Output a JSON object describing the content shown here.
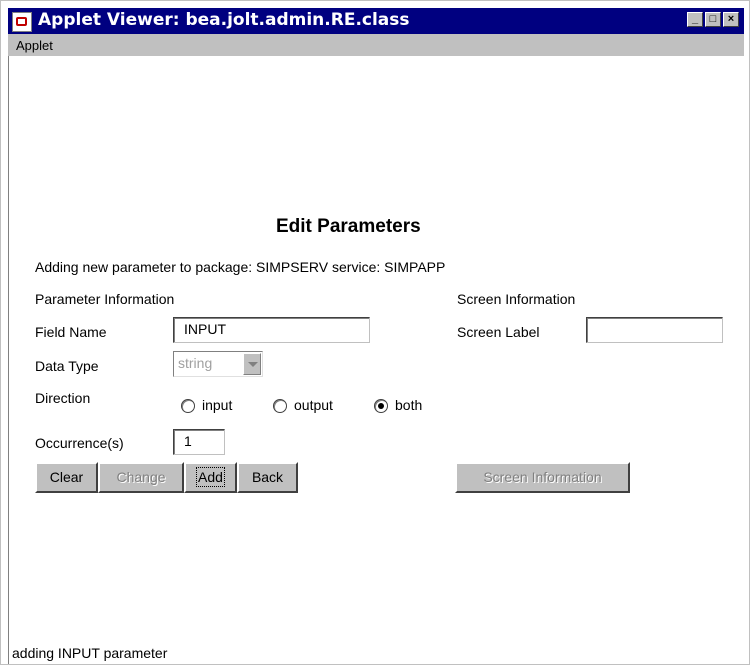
{
  "window": {
    "title": "Applet Viewer: bea.jolt.admin.RE.class",
    "controls": {
      "minimize": "_",
      "maximize": "□",
      "close": "×"
    }
  },
  "menubar": {
    "items": [
      "Applet"
    ]
  },
  "form": {
    "heading": "Edit Parameters",
    "subtitle": "Adding new parameter to package: SIMPSERV service: SIMPAPP",
    "param_section": "Parameter Information",
    "screen_section": "Screen Information",
    "field_name_label": "Field Name",
    "field_name_value": "INPUT",
    "screen_label_label": "Screen Label",
    "screen_label_value": "",
    "data_type_label": "Data Type",
    "data_type_value": "string",
    "direction_label": "Direction",
    "direction_options": [
      "input",
      "output",
      "both"
    ],
    "direction_selected": "both",
    "occurrence_label": "Occurrence(s)",
    "occurrence_value": "1"
  },
  "buttons": {
    "clear": "Clear",
    "change": "Change",
    "add": "Add",
    "back": "Back",
    "screen_info": "Screen Information"
  },
  "status": "adding INPUT parameter",
  "colors": {
    "titlebar": "#000080",
    "chrome": "#c0c0c0"
  }
}
